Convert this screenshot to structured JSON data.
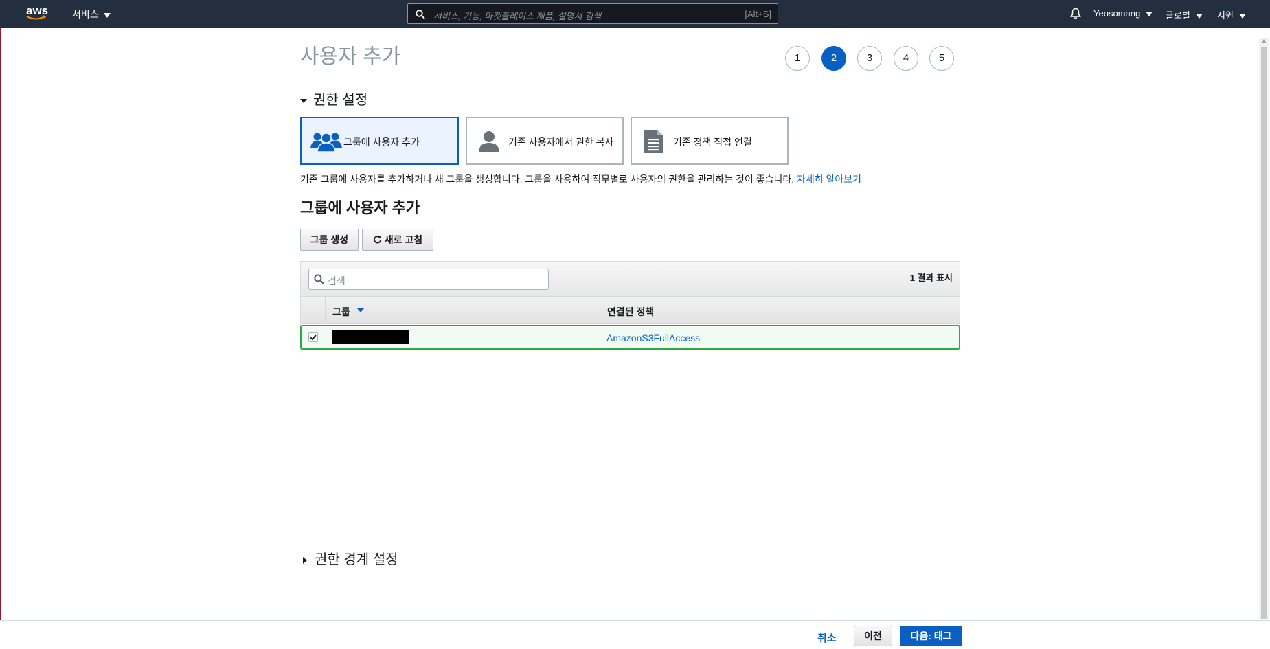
{
  "nav": {
    "logo_text": "aws",
    "services_label": "서비스",
    "search_placeholder": "서비스, 기능, 마켓플레이스 제품, 설명서 검색",
    "search_shortcut": "[Alt+S]",
    "user": "Yeosomang",
    "region": "글로벌",
    "support": "지원"
  },
  "page": {
    "title": "사용자 추가",
    "steps": [
      "1",
      "2",
      "3",
      "4",
      "5"
    ],
    "active_step": "2"
  },
  "permissions": {
    "heading": "권한 설정",
    "options": [
      {
        "label": "그룹에 사용자 추가",
        "icon": "users-group-icon",
        "selected": true
      },
      {
        "label": "기존 사용자에서 권한 복사",
        "icon": "user-icon",
        "selected": false
      },
      {
        "label": "기존 정책 직접 연결",
        "icon": "document-icon",
        "selected": false
      }
    ],
    "description": "기존 그룹에 사용자를 추가하거나 새 그룹을 생성합니다. 그룹을 사용하여 직무별로 사용자의 권한을 관리하는 것이 좋습니다.",
    "learn_more": "자세히 알아보기"
  },
  "group_section": {
    "heading": "그룹에 사용자 추가",
    "create_group_button": "그룹 생성",
    "refresh_button": "새로 고침",
    "search_placeholder": "검색",
    "result_count": "1 결과 표시",
    "columns": [
      "그룹",
      "연결된 정책"
    ],
    "rows": [
      {
        "group": "",
        "policy": "AmazonS3FullAccess",
        "checked": true
      }
    ]
  },
  "boundary": {
    "heading": "권한 경계 설정"
  },
  "footer": {
    "cancel": "취소",
    "previous": "이전",
    "next": "다음: 태그"
  },
  "colors": {
    "nav_bg": "#232f3e",
    "primary": "#0a5fc2",
    "selected_row_border": "#2ea944"
  }
}
